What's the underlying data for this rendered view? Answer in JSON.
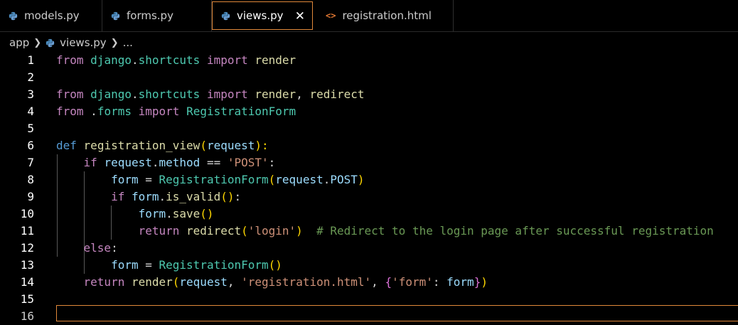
{
  "tabs": [
    {
      "label": "models.py",
      "icon": "python-icon"
    },
    {
      "label": "forms.py",
      "icon": "python-icon"
    },
    {
      "label": "views.py",
      "icon": "python-icon",
      "active": true
    },
    {
      "label": "registration.html",
      "icon": "html-icon"
    }
  ],
  "breadcrumb": {
    "folder": "app",
    "file": "views.py",
    "more": "..."
  },
  "line_numbers": [
    "1",
    "2",
    "3",
    "4",
    "5",
    "6",
    "7",
    "8",
    "9",
    "10",
    "11",
    "12",
    "13",
    "14",
    "15",
    "16"
  ],
  "code": {
    "l1": [
      "from",
      "django",
      ".",
      "shortcuts",
      "import",
      "render"
    ],
    "l3": [
      "from",
      "django",
      ".",
      "shortcuts",
      "import",
      "render",
      ",",
      "redirect"
    ],
    "l4": [
      "from",
      ".",
      "forms",
      "import",
      "RegistrationForm"
    ],
    "l6": [
      "def",
      "registration_view",
      "(",
      "request",
      "):"
    ],
    "l7": [
      "if",
      "request",
      ".",
      "method",
      "==",
      "'POST'",
      ":"
    ],
    "l8": [
      "form",
      "=",
      "RegistrationForm",
      "(",
      "request",
      ".",
      "POST",
      ")"
    ],
    "l9": [
      "if",
      "form",
      ".",
      "is_valid",
      "()",
      ":"
    ],
    "l10": [
      "form",
      ".",
      "save",
      "()"
    ],
    "l11": [
      "return",
      "redirect",
      "(",
      "'login'",
      ")",
      "# Redirect to the login page after successful registration"
    ],
    "l12": [
      "else",
      ":"
    ],
    "l13": [
      "form",
      "=",
      "RegistrationForm",
      "()"
    ],
    "l14": [
      "return",
      "render",
      "(",
      "request",
      ",",
      "'registration.html'",
      ",",
      "{",
      "'form'",
      ":",
      "form",
      "}",
      ")"
    ]
  },
  "colors": {
    "accent_border": "#e0883a",
    "background": "#000000",
    "keyword": "#569cd6",
    "control": "#c586c0",
    "class": "#4ec9b0",
    "string": "#ce9178",
    "comment": "#6a9955"
  }
}
